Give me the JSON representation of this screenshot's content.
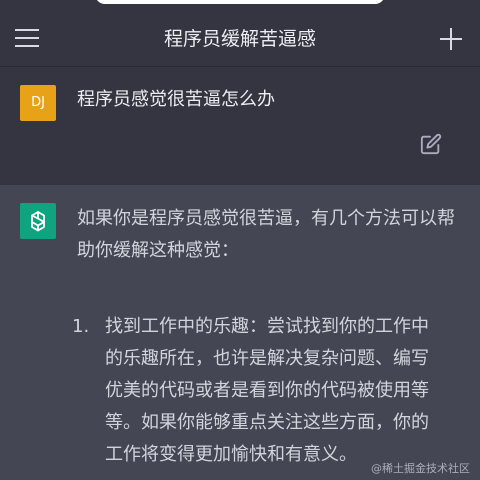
{
  "header": {
    "title": "程序员缓解苦逼感"
  },
  "user_message": {
    "avatar_initials": "DJ",
    "text": "程序员感觉很苦逼怎么办"
  },
  "assistant_message": {
    "intro": "如果你是程序员感觉很苦逼，有几个方法可以帮助你缓解这种感觉：",
    "items": [
      {
        "number": "1.",
        "text": "找到工作中的乐趣：尝试找到你的工作中的乐趣所在，也许是解决复杂问题、编写优美的代码或者是看到你的代码被使用等等。如果你能够重点关注这些方面，你的工作将变得更加愉快和有意义。"
      }
    ]
  },
  "watermark": "@稀土掘金技术社区",
  "colors": {
    "topbar_bg": "#343541",
    "assistant_bg": "#444654",
    "user_avatar": "#e8a217",
    "gpt_avatar": "#10a37f"
  }
}
